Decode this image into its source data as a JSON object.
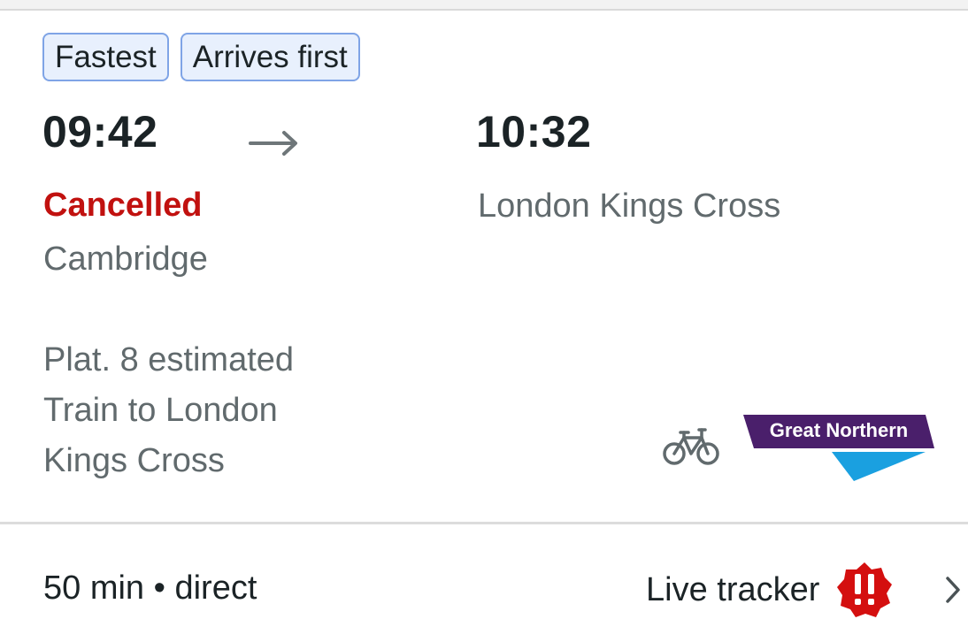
{
  "badges": {
    "fastest": "Fastest",
    "arrives_first": "Arrives first"
  },
  "journey": {
    "departure_time": "09:42",
    "arrival_time": "10:32",
    "status": "Cancelled",
    "origin": "Cambridge",
    "destination": "London Kings Cross",
    "platform": "Plat. 8 estimated",
    "service_line1": "Train to London",
    "service_line2": "Kings Cross"
  },
  "operator": {
    "name": "Great Northern",
    "brand_purple": "#4a1f6b",
    "brand_blue": "#1aa0e0"
  },
  "footer": {
    "duration": "50 min • direct",
    "live_tracker": "Live tracker"
  },
  "icons": {
    "arrow": "arrow-right-icon",
    "bike": "bicycle-icon",
    "alert": "alert-badge-icon",
    "chevron": "chevron-right-icon"
  },
  "colors": {
    "cancelled": "#c1110f",
    "badge_border": "#7fa4e6",
    "badge_fill": "#e8f0fd",
    "secondary_text": "#616a6d",
    "alert_red": "#d40f0f"
  }
}
